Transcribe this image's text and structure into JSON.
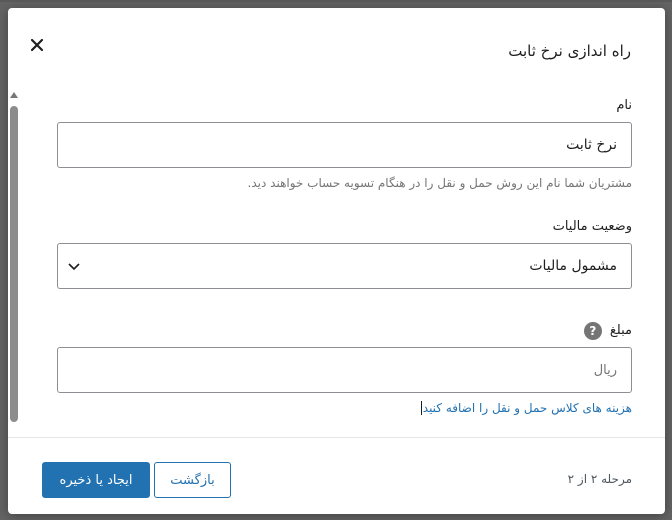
{
  "modal": {
    "title": "راه اندازی نرخ ثابت"
  },
  "fields": {
    "name": {
      "label": "نام",
      "value": "نرخ ثابت",
      "help": "مشتریان شما نام این روش حمل و نقل را در هنگام تسویه حساب خواهند دید."
    },
    "tax_status": {
      "label": "وضعیت مالیات",
      "selected": "مشمول مالیات"
    },
    "amount": {
      "label": "مبلغ",
      "help_icon_glyph": "?",
      "placeholder": "ریال",
      "link": "هزینه های کلاس حمل و نقل را اضافه کنید"
    }
  },
  "footer": {
    "step": "مرحله ۲ از ۲",
    "back_label": "بازگشت",
    "save_label": "ایجاد یا ذخیره"
  },
  "colors": {
    "primary": "#2271b1",
    "help_icon": "#757575"
  }
}
